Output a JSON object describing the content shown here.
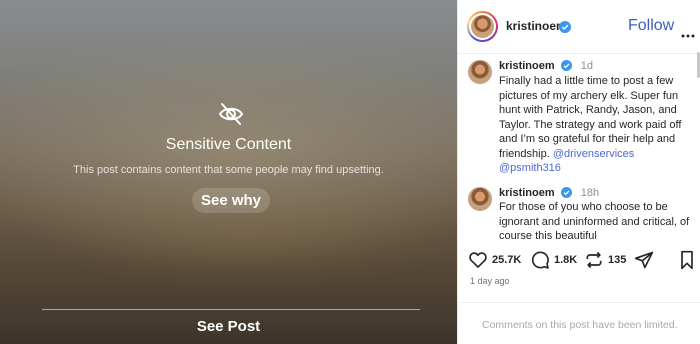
{
  "media": {
    "title": "Sensitive Content",
    "description": "This post contains content that some people may find upsetting.",
    "see_why_label": "See why",
    "see_post_label": "See Post"
  },
  "header": {
    "username": "kristinoem",
    "follow_label": "Follow"
  },
  "comments": [
    {
      "username": "kristinoem",
      "time": "1d",
      "text": "Finally had a little time to post a few pictures of my archery elk. Super fun hunt with Patrick, Randy, Jason, and Taylor. The strategy and work paid off and I’m so grateful for their help and friendship.",
      "mentions": [
        "@drivenservices",
        "@psmith316"
      ]
    },
    {
      "username": "kristinoem",
      "time": "18h",
      "text": "For those of you who choose to be ignorant and uninformed and critical, of course this beautiful"
    }
  ],
  "actions": {
    "likes": "25.7K",
    "comments": "1.8K",
    "reposts": "135"
  },
  "post_date": "1 day ago",
  "footer": {
    "limited_text": "Comments on this post have been limited."
  },
  "colors": {
    "accent": "#3b5fc0",
    "mention": "#4a6ad6",
    "verified": "#3897f0"
  }
}
